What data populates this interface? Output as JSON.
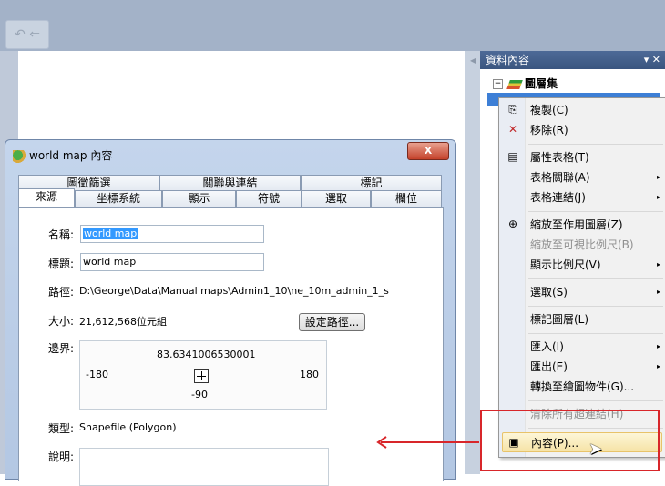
{
  "toolbar": {
    "icon": "arrow-left-icon"
  },
  "toc": {
    "title": "資料內容",
    "pin": "▾",
    "close": "✕",
    "root_label": "圖層集",
    "expander": "−"
  },
  "menu": {
    "items": [
      {
        "label": "複製(C)",
        "icon": "copy-icon",
        "glyph": "⎘"
      },
      {
        "label": "移除(R)",
        "icon": "remove-icon",
        "glyph": "✕"
      },
      {
        "label": "屬性表格(T)",
        "icon": "table-icon",
        "glyph": "▤"
      },
      {
        "label": "表格關聯(A)",
        "submenu": true
      },
      {
        "label": "表格連結(J)",
        "submenu": true
      },
      {
        "label": "縮放至作用圖層(Z)",
        "icon": "zoom-layer-icon",
        "glyph": "⊕"
      },
      {
        "label": "縮放至可視比例尺(B)",
        "disabled": true
      },
      {
        "label": "顯示比例尺(V)",
        "submenu": true
      },
      {
        "label": "選取(S)",
        "submenu": true
      },
      {
        "label": "標記圖層(L)"
      },
      {
        "label": "匯入(I)",
        "submenu": true
      },
      {
        "label": "匯出(E)",
        "submenu": true
      },
      {
        "label": "轉換至繪圖物件(G)..."
      },
      {
        "label": "清除所有超連結(H)",
        "disabled": true
      },
      {
        "label": "內容(P)...",
        "icon": "properties-icon",
        "glyph": "▣",
        "highlighted": true
      }
    ],
    "submenu_glyph": "▸"
  },
  "dialog": {
    "title": "world map 內容",
    "close_label": "X",
    "tabs_row1": [
      "圖徵篩選",
      "關聯與連結",
      "標記"
    ],
    "tabs_row2": [
      "來源",
      "坐標系統",
      "顯示",
      "符號",
      "選取",
      "欄位"
    ],
    "name_label": "名稱:",
    "name_value": "world map",
    "label_label": "標題:",
    "label_value": "world map",
    "path_label": "路徑:",
    "path_value": "D:\\George\\Data\\Manual maps\\Admin1_10\\ne_10m_admin_1_s",
    "size_label": "大小:",
    "size_value": "21,612,568位元組",
    "set_path_button": "設定路徑...",
    "extent_label": "邊界:",
    "extent": {
      "top": "83.6341006530001",
      "left": "-180",
      "right": "180",
      "bottom": "-90"
    },
    "type_label": "類型:",
    "type_value": "Shapefile (Polygon)",
    "description_label": "說明:"
  },
  "colors": {
    "annotation_red": "#d8262a",
    "selection_blue": "#3d7fd6",
    "menu_highlight": "#f6e3a6"
  }
}
